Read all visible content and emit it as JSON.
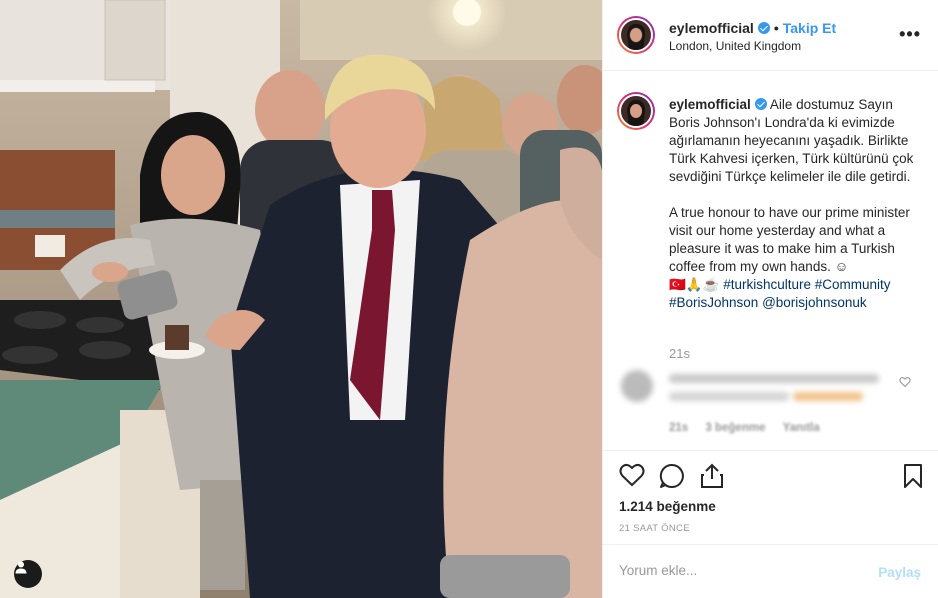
{
  "post": {
    "username": "eylemofficial",
    "follow_label": "Takip Et",
    "location": "London, United Kingdom",
    "more_icon": "more-options-icon",
    "photo_alt": "Boris Johnson'a Türk kahvesi ikram"
  },
  "caption": {
    "username": "eylemofficial",
    "turkish": "Aile dostumuz Sayın Boris Johnson'ı Londra'da ki evimizde ağırlamanın heyecanını yaşadık. Birlikte Türk Kahvesi içerken, Türk kültürünü çok sevdiğini Türkçe kelimeler ile dile getirdi.",
    "english": "A true honour to have our prime minister visit our home yesterday and what a pleasure it was to make him a Turkish coffee from my own hands. ☺",
    "emoji": "🇹🇷🙏☕",
    "tags": [
      "#turkishculture",
      "#Community",
      "#BorisJohnson",
      "@borisjohnsonuk"
    ],
    "time": "21s"
  },
  "comment": {
    "time": "21s",
    "likes": "3 beğenme",
    "reply": "Yanıtla"
  },
  "actions": {
    "likes_count": "1.214 beğenme",
    "posted_ago": "21 SAAT ÖNCE"
  },
  "add_comment": {
    "placeholder": "Yorum ekle...",
    "share_label": "Paylaş"
  },
  "colors": {
    "accent": "#3897f0",
    "share_disabled": "#b2dffc",
    "divider": "#efefef",
    "muted": "#999999"
  }
}
